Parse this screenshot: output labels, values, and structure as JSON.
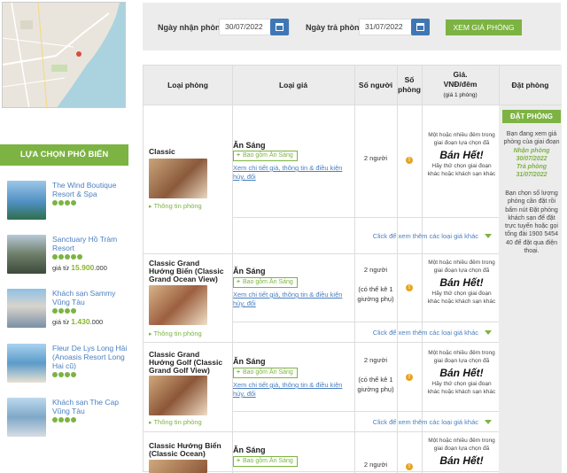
{
  "search": {
    "checkin_label": "Ngày nhận phòng",
    "checkin_value": "30/07/2022",
    "checkout_label": "Ngày trả phòng",
    "checkout_value": "31/07/2022",
    "view_button": "XEM GIÁ PHÒNG"
  },
  "table_headers": {
    "room_type": "Loại phòng",
    "rate_type": "Loại giá",
    "persons": "Số người",
    "rooms_line1": "Số",
    "rooms_line2": "phòng",
    "price_line1": "Giá.",
    "price_line2": "VNĐ/đêm",
    "price_line3": "(giá 1 phòng)",
    "book": "Đặt phòng"
  },
  "rooms": [
    {
      "name": "Classic",
      "info": "Thông tin phòng",
      "rate": "Ăn Sáng",
      "included": "Bao gồm Ăn Sáng",
      "detail": "Xem chi tiết giá, thông tin & điều kiện hủy, đổi",
      "persons": "2 người",
      "more": "Click để xem thêm các loại giá khác"
    },
    {
      "name": "Classic Grand Hướng Biển (Classic Grand Ocean View)",
      "info": "Thông tin phòng",
      "rate": "Ăn Sáng",
      "included": "Bao gồm Ăn Sáng",
      "detail": "Xem chi tiết giá, thông tin & điều kiện hủy, đổi",
      "persons": "2 người",
      "extra": "(có thể kê 1 giường phụ)",
      "more": "Click để xem thêm các loại giá khác"
    },
    {
      "name": "Classic Grand Hướng Golf (Classic Grand Golf View)",
      "info": "Thông tin phòng",
      "rate": "Ăn Sáng",
      "included": "Bao gồm Ăn Sáng",
      "detail": "Xem chi tiết giá, thông tin & điều kiện hủy, đổi",
      "persons": "2 người",
      "extra": "(có thể kê 1 giường phụ)",
      "more": "Click để xem thêm các loại giá khác"
    },
    {
      "name": "Classic Hướng Biển (Classic Ocean)",
      "rate": "Ăn Sáng",
      "included": "Bao gồm Ăn Sáng",
      "persons": "2 người"
    }
  ],
  "sold_out": {
    "line1": "Một hoặc nhiều đêm trong giai đoạn lựa chọn đã",
    "big": "Bán Hết!",
    "line2": "Hãy thử chọn giai đoạn khác hoặc khách sạn khác"
  },
  "booking": {
    "button": "ĐẶT PHÒNG",
    "viewing": "Bạn đang xem giá phòng của giai đoạn",
    "checkin_label": "Nhận phòng",
    "checkin": "30/07/2022",
    "checkout_label": "Trả phòng",
    "checkout": "31/07/2022",
    "instructions": "Bạn chọn số lượng phòng cần đặt rồi bấm nút Đặt phòng khách sạn để đặt trực tuyến hoặc gọi tổng đài 1900 5454 40 để đặt qua điện thoại."
  },
  "popular": {
    "title": "LỰA CHỌN PHỔ BIẾN",
    "hotels": [
      {
        "name": "The Wind Boutique Resort & Spa",
        "stars": 4
      },
      {
        "name": "Sanctuary Hồ Tràm Resort",
        "stars": 5,
        "price_prefix": "giá từ",
        "price_main": "15.900",
        "price_suffix": ".000"
      },
      {
        "name": "Khách sạn Sammy Vũng Tàu",
        "stars": 4,
        "price_prefix": "giá từ",
        "price_main": "1.430",
        "price_suffix": ".000"
      },
      {
        "name": "Fleur De Lys Long Hải (Anoasis Resort Long Hai cũ)",
        "stars": 4
      },
      {
        "name": "Khách sạn The Cap Vũng Tàu",
        "stars": 4
      }
    ]
  },
  "colors": {
    "accent": "#7cb342",
    "link": "#4a7fc1",
    "calendar": "#3f77b5",
    "info": "#e8a321"
  }
}
